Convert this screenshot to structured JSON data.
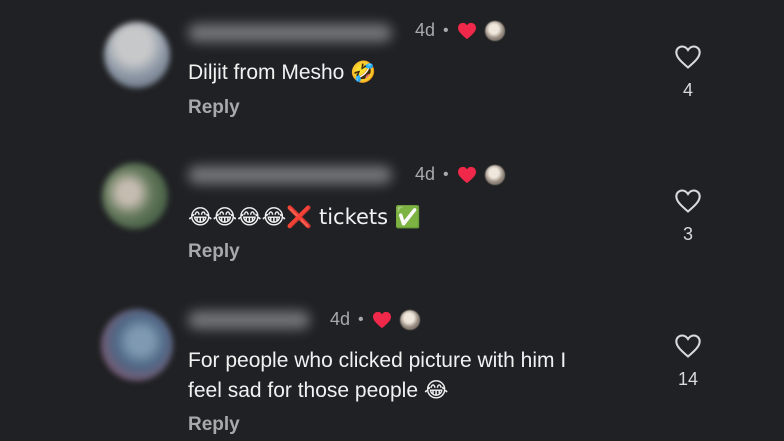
{
  "comments": [
    {
      "time": "4d",
      "text": "Diljit from Mesho 🤣",
      "text_lines": [
        "Diljit from Mesho 🤣"
      ],
      "reply": "Reply",
      "likes": "4",
      "avatar_colors": [
        "#a9b0b7",
        "#6b7789"
      ]
    },
    {
      "time": "4d",
      "text": "😂😂😂😂❌ tickets ✅",
      "text_lines": [
        "😂😂😂😂❌ tickets ✅"
      ],
      "reply": "Reply",
      "likes": "3",
      "avatar_colors": [
        "#3f6b3e",
        "#6a8c5e"
      ]
    },
    {
      "time": "4d",
      "text": "For people who clicked picture with him I feel sad for those people 😂",
      "text_lines": [
        "For people who clicked picture with him I",
        "feel sad for those people 😂"
      ],
      "reply": "Reply",
      "likes": "14",
      "avatar_colors": [
        "#7f5a6e",
        "#3f5f79"
      ]
    }
  ],
  "colors": {
    "background": "#202124",
    "text": "#f1f1f2",
    "secondary_text": "#a8a9ad",
    "heart_red": "#f02849"
  },
  "icons": {
    "like": "heart-outline-icon",
    "creator_like": "red-heart-icon",
    "separator": "dot-icon"
  }
}
